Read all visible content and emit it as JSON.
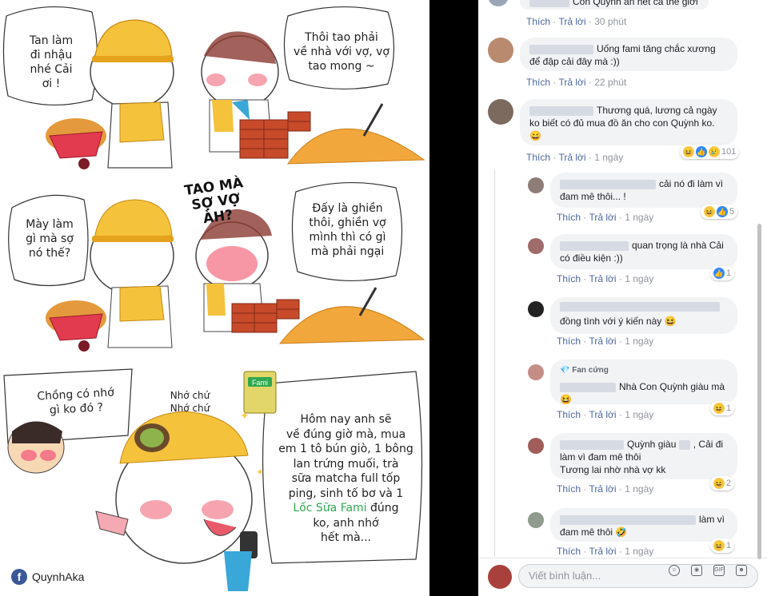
{
  "comic": {
    "panel1": {
      "left_bubble": "Tan làm\nđi nhậu\nnhé Cải\nơi !",
      "right_bubble": "Thôi tao phải\nvề nhà với vợ, vợ\ntao mong ~"
    },
    "panel2": {
      "left_bubble": "Mày làm\ngì mà sợ\nnó thế?",
      "sfx": "TAO MÀ\nSỢ VỢ ÀH?",
      "right_bubble": "Đấy là ghiền\nthôi, ghiền vợ\nmình thì có gì\nmà phải ngại"
    },
    "panel3": {
      "left_bubble": "Chồng có nhớ\ngì ko đó ?",
      "whisper": "Nhớ chứ\nNhớ chứ",
      "product": "Fami",
      "right_text_before": "Hôm nay anh sẽ\nvề đúng giờ mà, mua\nem 1 tô bún giò, 1 bông\nlan trứng muối, trà\nsữa matcha full tốp\nping, sinh tố bơ và 1",
      "right_highlight": "Lốc Sữa Fami",
      "right_text_after": " đúng\nko, anh nhớ\nhết mà..."
    },
    "credit": "QuynhAka",
    "credit_icon": "f"
  },
  "comments": [
    {
      "text": "Con Quỳnh ăn hết cả thế giới",
      "like": "Thích",
      "reply": "Trả lời",
      "time": "30 phút"
    },
    {
      "text": "Uống fami tăng chắc xương để đập cải đây mà :))",
      "like": "Thích",
      "reply": "Trả lời",
      "time": "22 phút"
    },
    {
      "text": "Thương quá, lương cả ngày ko biết có đủ mua đồ ăn cho con Quỳnh ko.",
      "like": "Thích",
      "reply": "Trả lời",
      "time": "1 ngày",
      "reaction_count": "101"
    }
  ],
  "replies": [
    {
      "text": "cải nó đi làm vì đam mê thôi... !",
      "like": "Thích",
      "reply": "Trả lời",
      "time": "1 ngày",
      "reaction_count": "5"
    },
    {
      "text": "quan trọng là nhà Cải có điều kiện :))",
      "like": "Thích",
      "reply": "Trả lời",
      "time": "1 ngày",
      "reaction_count": "1"
    },
    {
      "text": "đồng tình với ý kiến này",
      "like": "Thích",
      "reply": "Trả lời",
      "time": "1 ngày"
    },
    {
      "badge": "Fan cứng",
      "text": "Nhà Con Quỳnh giàu mà",
      "like": "Thích",
      "reply": "Trả lời",
      "time": "1 ngày",
      "reaction_count": "1"
    },
    {
      "name_partial": "N___ễ_Tr_",
      "text_line1": "Quỳnh giàu",
      "text_line1b": ", Cải đi làm vì đam mê thôi",
      "text_line2": "Tương lai nhờ nhà vợ kk",
      "like": "Thích",
      "reply": "Trả lời",
      "time": "1 ngày",
      "reaction_count": "2"
    },
    {
      "text": "làm vì đam mê thôi",
      "like": "Thích",
      "reply": "Trả lời",
      "time": "1 ngày",
      "reaction_count": "1"
    }
  ],
  "compose": {
    "placeholder": "Viết bình luận...",
    "icons": [
      "smiley-icon",
      "camera-icon",
      "gif-icon",
      "sticker-icon"
    ]
  },
  "colors": {
    "link": "#4b67a1",
    "meta": "#90949c",
    "bubble": "#f2f3f5",
    "highlight": "#2fa84f"
  }
}
